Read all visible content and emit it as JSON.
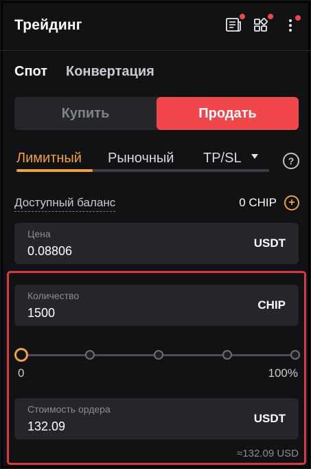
{
  "header": {
    "title": "Трейдинг",
    "icons": [
      "news-icon",
      "apps-icon",
      "more-icon"
    ],
    "notification_color": "#f0464c"
  },
  "tabs": [
    {
      "label": "Спот",
      "active": true
    },
    {
      "label": "Конвертация",
      "active": false
    }
  ],
  "side": {
    "buy_label": "Купить",
    "sell_label": "Продать",
    "selected": "sell",
    "sell_color": "#f0464c"
  },
  "order_types": [
    {
      "label": "Лимитный",
      "active": true
    },
    {
      "label": "Рыночный",
      "active": false
    },
    {
      "label": "TP/SL",
      "active": false
    }
  ],
  "accent_color": "#f0a23b",
  "balance": {
    "label": "Доступный баланс",
    "value": "0 CHIP"
  },
  "price": {
    "label": "Цена",
    "value": "0.08806",
    "unit": "USDT"
  },
  "quantity": {
    "label": "Количество",
    "value": "1500",
    "unit": "CHIP"
  },
  "slider": {
    "min_label": "0",
    "max_label": "100%",
    "value": 0,
    "marks": [
      0,
      25,
      50,
      75,
      100
    ]
  },
  "order_value": {
    "label": "Стоимость ордера",
    "value": "132.09",
    "unit": "USDT",
    "approx": "≈132.09 USD"
  }
}
